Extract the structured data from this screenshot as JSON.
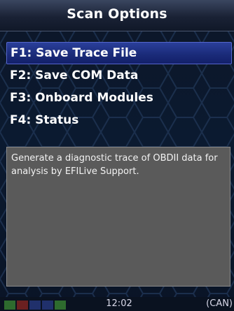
{
  "title": "Scan Options",
  "menu": {
    "items": [
      {
        "label": "F1: Save Trace File",
        "selected": true
      },
      {
        "label": "F2: Save COM Data",
        "selected": false
      },
      {
        "label": "F3: Onboard Modules",
        "selected": false
      },
      {
        "label": "F4: Status",
        "selected": false
      }
    ]
  },
  "description": "Generate a diagnostic trace of OBDII data for analysis by EFILive Support.",
  "status": {
    "time": "12:02",
    "protocol": "(CAN)",
    "indicator_colors": [
      "#2e6b2e",
      "#6b2020",
      "#20306b",
      "#20306b",
      "#2e6b2e"
    ]
  },
  "colors": {
    "selected_bg": "#1a2a78",
    "panel_bg": "#5a5a5a"
  }
}
